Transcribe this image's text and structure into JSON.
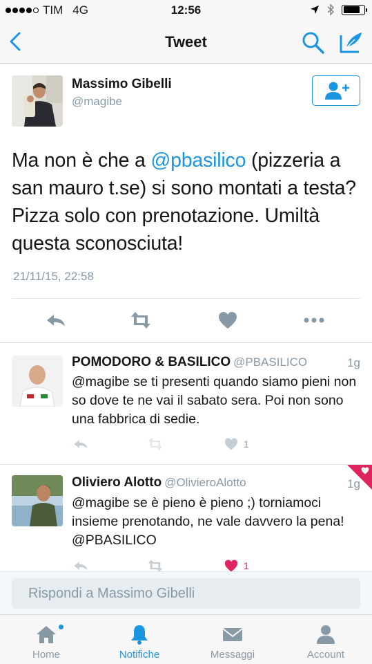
{
  "status_bar": {
    "carrier": "TIM",
    "network": "4G",
    "time": "12:56"
  },
  "nav": {
    "title": "Tweet",
    "back_icon": "chevron-left-icon",
    "search_icon": "search-icon",
    "compose_icon": "compose-icon"
  },
  "main_tweet": {
    "name": "Massimo Gibelli",
    "handle": "@magibe",
    "text_before": "Ma non è che a ",
    "mention": "@pbasilico",
    "text_after": " (pizzeria a san mauro t.se) si sono montati a testa? Pizza solo con prenotazione. Umiltà questa sconosciuta!",
    "date": "21/11/15, 22:58",
    "follow_icon": "add-user-icon"
  },
  "replies": [
    {
      "name": "POMODORO & BASILICO",
      "handle": "@PBASILICO",
      "time": "1g",
      "text": "@magibe se ti presenti quando siamo pieni non so dove te ne vai il sabato sera. Poi non sono una fabbrica di sedie.",
      "like_count": "1",
      "liked": false
    },
    {
      "name": "Oliviero Alotto",
      "handle": "@OlivieroAlotto",
      "time": "1g",
      "text": "@magibe se è pieno è pieno ;) torniamoci insieme prenotando, ne vale davvero la pena! @PBASILICO",
      "like_count": "1",
      "liked": true
    }
  ],
  "reply_bar": {
    "placeholder": "Rispondi a Massimo Gibelli"
  },
  "tabs": [
    {
      "label": "Home",
      "icon": "home-icon",
      "active": false,
      "has_dot": true
    },
    {
      "label": "Notifiche",
      "icon": "bell-icon",
      "active": true
    },
    {
      "label": "Messaggi",
      "icon": "envelope-icon",
      "active": false
    },
    {
      "label": "Account",
      "icon": "person-icon",
      "active": false
    }
  ],
  "colors": {
    "accent": "#1b95e0",
    "muted": "#8899a6",
    "like": "#e0245e",
    "text": "#14171a"
  }
}
